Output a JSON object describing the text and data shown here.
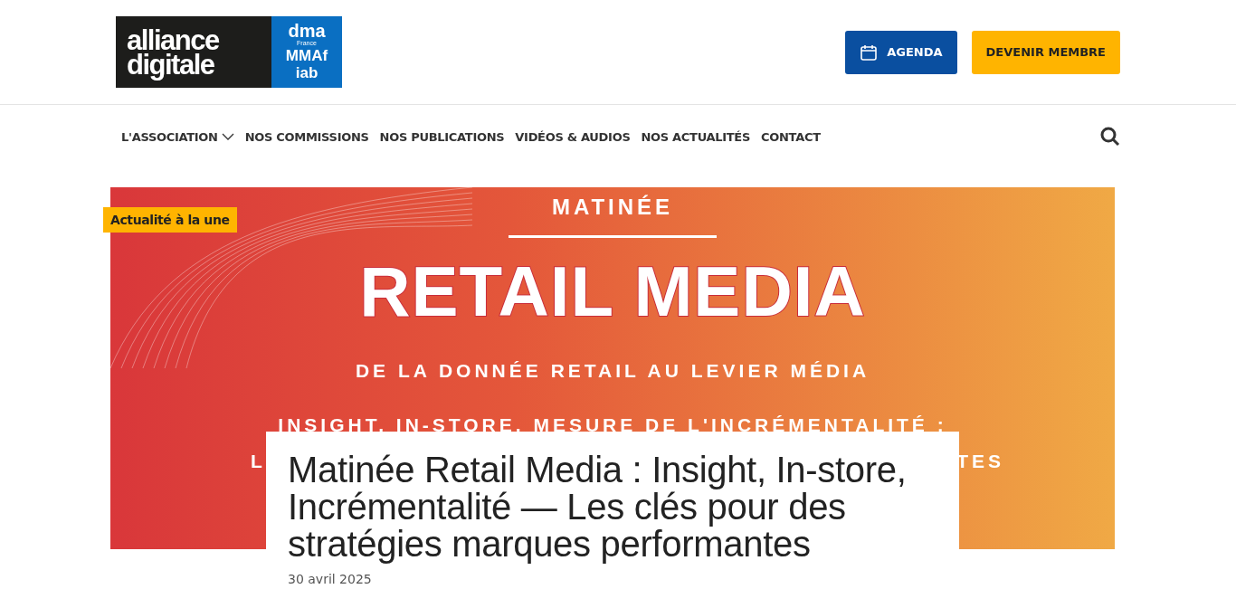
{
  "logo": {
    "main_lines": [
      "alliance",
      "digitale"
    ],
    "partner_texts": [
      {
        "kind": "dma",
        "text": "dma"
      },
      {
        "kind": "sub",
        "text": "France"
      },
      {
        "kind": "bold",
        "text": "MMAf"
      },
      {
        "kind": "iab",
        "text": "iab"
      }
    ]
  },
  "header_buttons": [
    {
      "kind": "agenda",
      "label": "AGENDA"
    },
    {
      "kind": "member",
      "label": "DEVENIR MEMBRE"
    }
  ],
  "nav": [
    {
      "label": "L'ASSOCIATION",
      "has_dropdown": true
    },
    {
      "label": "NOS COMMISSIONS",
      "has_dropdown": false
    },
    {
      "label": "NOS PUBLICATIONS",
      "has_dropdown": false
    },
    {
      "label": "VIDÉOS & AUDIOS",
      "has_dropdown": false
    },
    {
      "label": "NOS ACTUALITÉS",
      "has_dropdown": false
    },
    {
      "label": "CONTACT",
      "has_dropdown": false
    }
  ],
  "featured": {
    "badge": "Actualité à la une",
    "banner_lines": [
      {
        "kind": "small",
        "text": "MATINÉE"
      },
      {
        "kind": "rule"
      },
      {
        "kind": "big",
        "text": "RETAIL MEDIA"
      },
      {
        "kind": "sub",
        "text": "DE LA DONNÉE RETAIL AU LEVIER MÉDIA"
      },
      {
        "kind": "sub",
        "text": "INSIGHT, IN-STORE, MESURE DE L'INCRÉMENTALITÉ :"
      }
    ],
    "banner_partial": [
      "L",
      "TES"
    ],
    "title": "Matinée Retail Media : Insight, In-store, Incrémentalité — Les clés pour des stratégies marques performantes",
    "date": "30 avril 2025"
  }
}
